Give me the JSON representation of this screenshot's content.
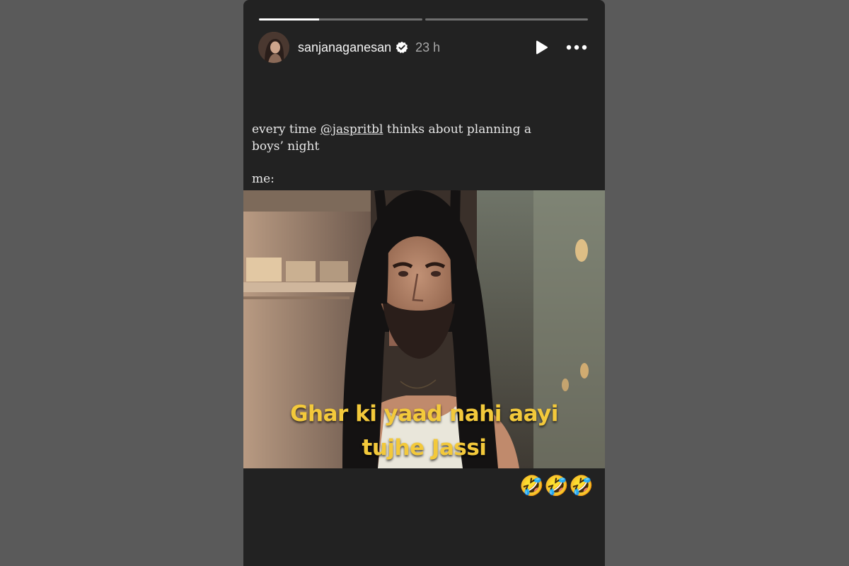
{
  "story": {
    "progress": [
      0.37,
      0.0
    ],
    "username": "sanjanaganesan",
    "time": "23 h",
    "caption": {
      "before": "every time ",
      "mention": "@jaspritbl",
      "after": " thinks about planning a boys’ night",
      "me": "me:"
    },
    "meme": {
      "line1": "Ghar ki yaad nahi aayi",
      "line2": "tujhe Jassi",
      "text_color": "#f3c93b"
    },
    "emoji": "🤣🤣🤣"
  },
  "icons": {
    "verified": "verified-badge-icon",
    "play": "play-icon",
    "more": "more-options-icon"
  },
  "colors": {
    "page_bg": "#5a5a5a",
    "story_bg": "#222222"
  }
}
